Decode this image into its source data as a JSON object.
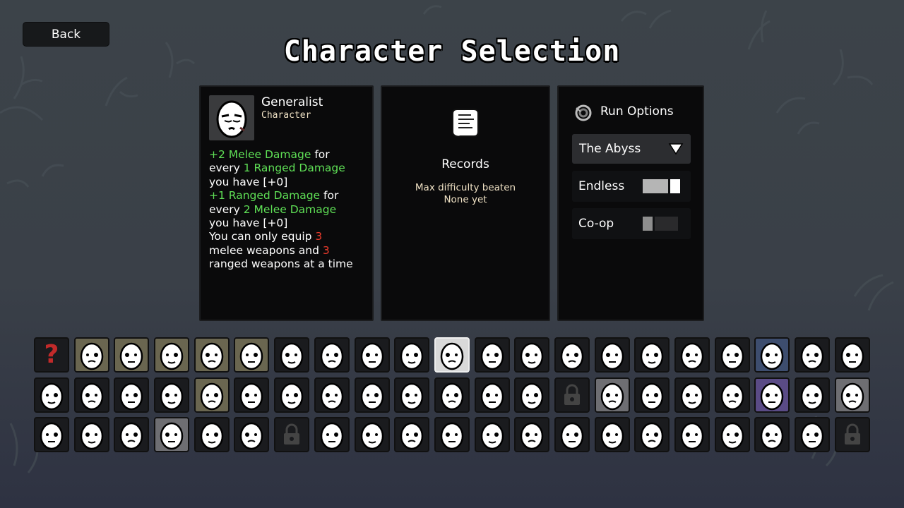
{
  "header": {
    "back_label": "Back",
    "title": "Character Selection"
  },
  "character": {
    "name": "Generalist",
    "subtitle": "Character",
    "description": [
      {
        "parts": [
          {
            "t": "+2 Melee Damage",
            "c": "g"
          },
          {
            "t": " for",
            "c": ""
          }
        ]
      },
      {
        "parts": [
          {
            "t": "every ",
            "c": ""
          },
          {
            "t": "1 Ranged Damage",
            "c": "g"
          }
        ]
      },
      {
        "parts": [
          {
            "t": "you have [+0]",
            "c": ""
          }
        ]
      },
      {
        "parts": [
          {
            "t": "+1 Ranged Damage",
            "c": "g"
          },
          {
            "t": " for",
            "c": ""
          }
        ]
      },
      {
        "parts": [
          {
            "t": "every ",
            "c": ""
          },
          {
            "t": "2 Melee Damage",
            "c": "g"
          }
        ]
      },
      {
        "parts": [
          {
            "t": "you have [+0]",
            "c": ""
          }
        ]
      },
      {
        "parts": [
          {
            "t": "You can only equip ",
            "c": ""
          },
          {
            "t": "3",
            "c": "r"
          }
        ]
      },
      {
        "parts": [
          {
            "t": "melee weapons and ",
            "c": ""
          },
          {
            "t": "3",
            "c": "r"
          }
        ]
      },
      {
        "parts": [
          {
            "t": "ranged weapons at a time",
            "c": ""
          }
        ]
      }
    ]
  },
  "records": {
    "title": "Records",
    "label": "Max difficulty beaten",
    "value": "None yet",
    "icon": "scroll-icon"
  },
  "run_options": {
    "title": "Run Options",
    "icon": "swirl-icon",
    "zone_selected": "The Abyss",
    "endless": {
      "label": "Endless",
      "on": true
    },
    "coop": {
      "label": "Co-op",
      "on": false
    }
  },
  "colors": {
    "positive": "#5fe056",
    "negative": "#ea3b2c",
    "panel": "#0a0a0b",
    "accent_text": "#efe1c4"
  },
  "roster": [
    [
      "random",
      "tan",
      "tan",
      "tan",
      "tan",
      "tan",
      "normal",
      "normal",
      "normal",
      "normal",
      "selected",
      "normal",
      "normal",
      "normal",
      "normal",
      "normal",
      "normal",
      "normal",
      "blue",
      "normal",
      "normal"
    ],
    [
      "normal",
      "normal",
      "normal",
      "normal",
      "tan",
      "normal",
      "normal",
      "normal",
      "normal",
      "normal",
      "normal",
      "normal",
      "normal",
      "locked",
      "grey",
      "normal",
      "normal",
      "normal",
      "purple",
      "normal",
      "grey"
    ],
    [
      "normal",
      "normal",
      "normal",
      "selectedgrey",
      "normal",
      "normal",
      "locked",
      "normal",
      "normal",
      "normal",
      "normal",
      "normal",
      "normal",
      "normal",
      "normal",
      "normal",
      "normal",
      "normal",
      "normal",
      "normal",
      "locked"
    ]
  ]
}
